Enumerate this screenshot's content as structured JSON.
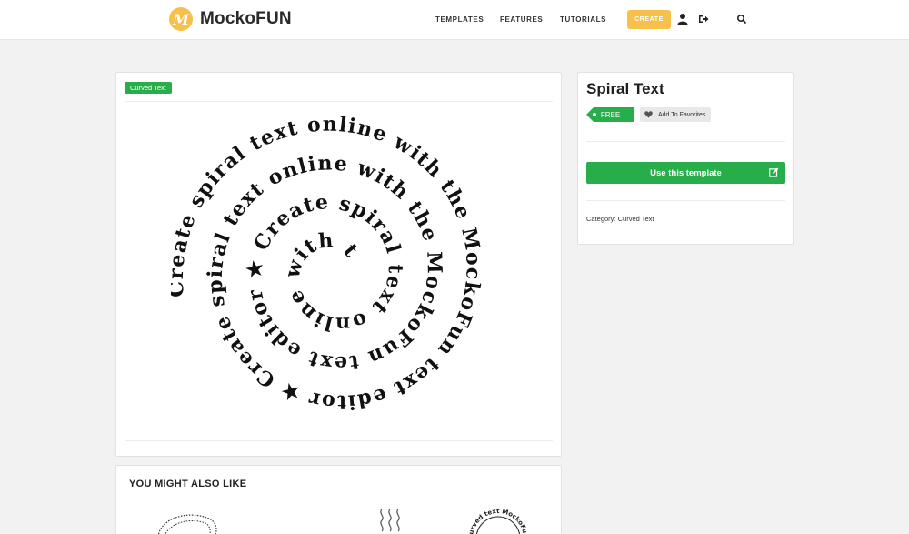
{
  "header": {
    "logo_text": "MockoFUN",
    "logo_letter": "M",
    "nav": [
      "TEMPLATES",
      "FEATURES",
      "TUTORIALS"
    ],
    "create_label": "CREATE",
    "icons": [
      "user-icon",
      "logout-icon",
      "search-icon"
    ]
  },
  "main": {
    "tag": "Curved Text",
    "spiral_text": "Create spiral text online with the MockoFun text editor ★ Create spiral text online with the MockoFun text editor ★ Create spiral text online with the",
    "spiral_text_color": "#111111"
  },
  "sidebar": {
    "title": "Spiral Text",
    "free_label": "FREE",
    "favorites_label": "Add To Favorites",
    "use_label": "Use this template",
    "category_prefix": "Category:",
    "category_value": "Curved Text"
  },
  "also_like": {
    "title": "YOU MIGHT ALSO LIKE",
    "thumb_text": "curved text MockoFun"
  },
  "colors": {
    "accent_green": "#27ae4a",
    "accent_yellow": "#f7c04a",
    "background": "#f2f2f2"
  }
}
